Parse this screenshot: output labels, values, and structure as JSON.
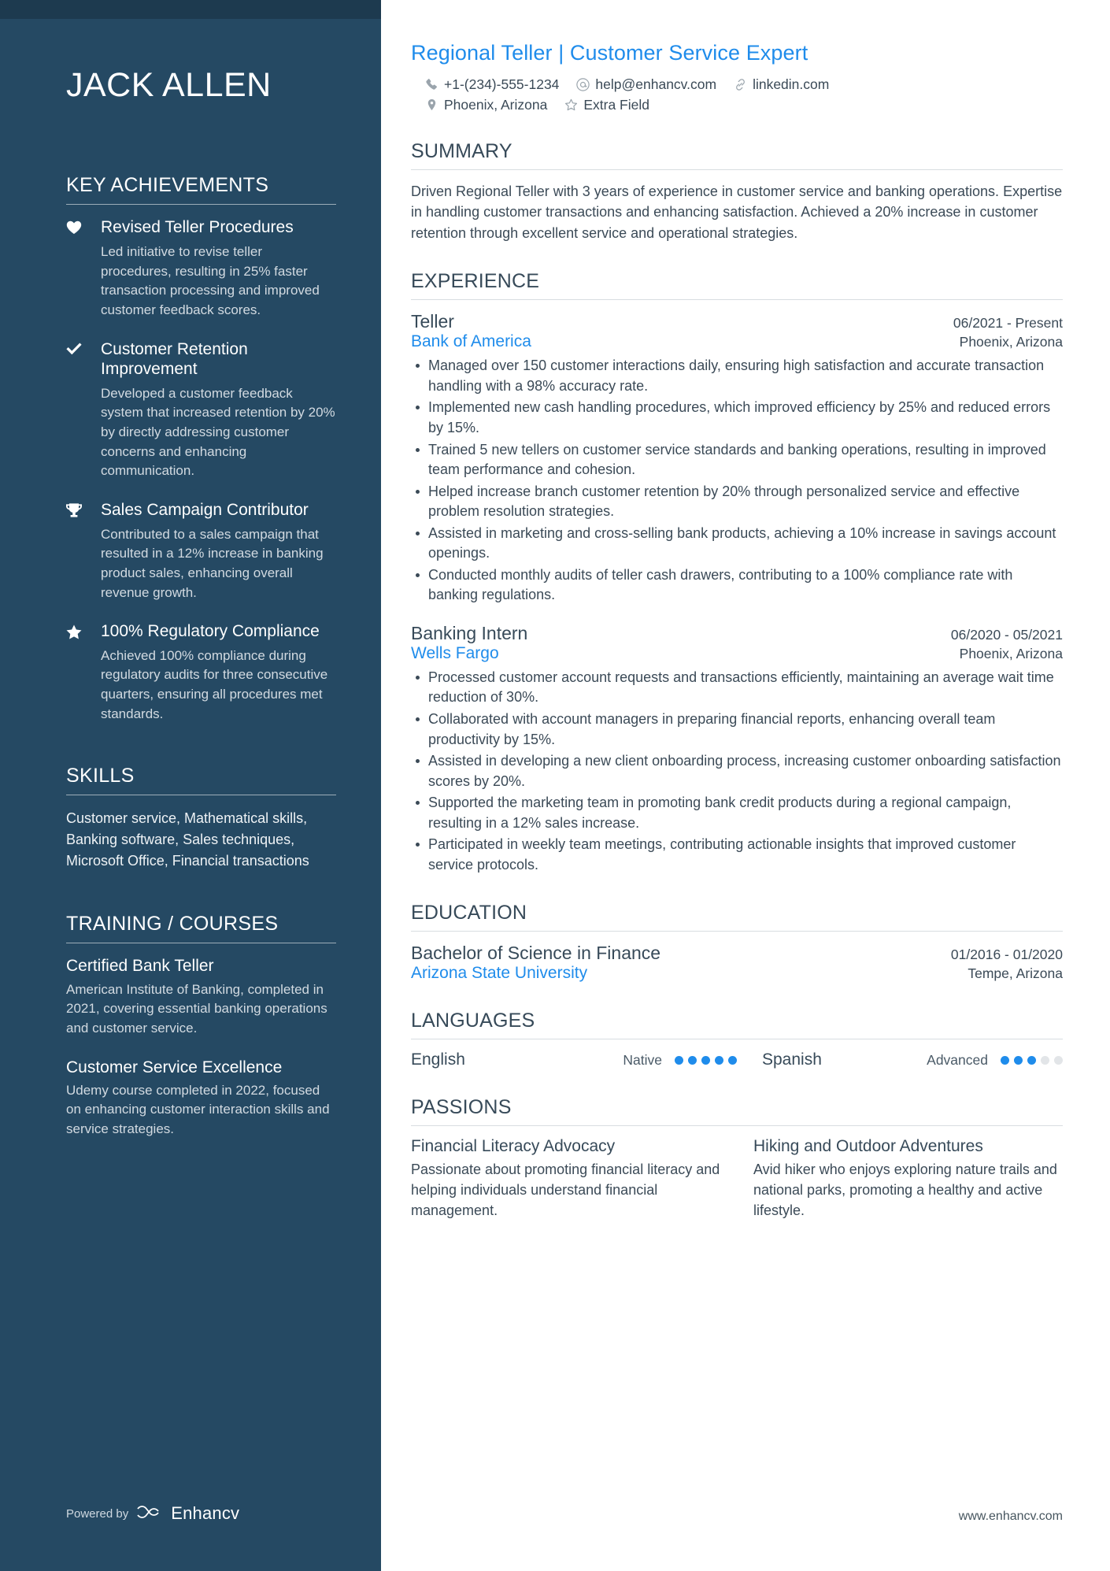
{
  "sidebar": {
    "name": "JACK ALLEN",
    "key_achievements": {
      "heading": "KEY ACHIEVEMENTS",
      "items": [
        {
          "icon": "heart-icon",
          "title": "Revised Teller Procedures",
          "description": "Led initiative to revise teller procedures, resulting in 25% faster transaction processing and improved customer feedback scores."
        },
        {
          "icon": "check-icon",
          "title": "Customer Retention Improvement",
          "description": "Developed a customer feedback system that increased retention by 20% by directly addressing customer concerns and enhancing communication."
        },
        {
          "icon": "trophy-icon",
          "title": "Sales Campaign Contributor",
          "description": "Contributed to a sales campaign that resulted in a 12% increase in banking product sales, enhancing overall revenue growth."
        },
        {
          "icon": "star-icon",
          "title": "100% Regulatory Compliance",
          "description": "Achieved 100% compliance during regulatory audits for three consecutive quarters, ensuring all procedures met standards."
        }
      ]
    },
    "skills": {
      "heading": "SKILLS",
      "text": "Customer service, Mathematical skills, Banking software, Sales techniques, Microsoft Office, Financial transactions"
    },
    "training": {
      "heading": "TRAINING / COURSES",
      "items": [
        {
          "title": "Certified Bank Teller",
          "description": "American Institute of Banking, completed in 2021, covering essential banking operations and customer service."
        },
        {
          "title": "Customer Service Excellence",
          "description": "Udemy course completed in 2022, focused on enhancing customer interaction skills and service strategies."
        }
      ]
    },
    "footer": {
      "powered_by": "Powered by",
      "brand": "Enhancv"
    }
  },
  "main": {
    "headline": "Regional Teller | Customer Service Expert",
    "contacts": [
      {
        "icon": "phone-icon",
        "text": "+1-(234)-555-1234"
      },
      {
        "icon": "email-icon",
        "text": "help@enhancv.com"
      },
      {
        "icon": "link-icon",
        "text": "linkedin.com"
      },
      {
        "icon": "location-pin-icon",
        "text": "Phoenix, Arizona"
      },
      {
        "icon": "star-outline-icon",
        "text": "Extra Field"
      }
    ],
    "summary": {
      "heading": "SUMMARY",
      "text": "Driven Regional Teller with 3 years of experience in customer service and banking operations. Expertise in handling customer transactions and enhancing satisfaction. Achieved a 20% increase in customer retention through excellent service and operational strategies."
    },
    "experience": {
      "heading": "EXPERIENCE",
      "entries": [
        {
          "title": "Teller",
          "date": "06/2021 - Present",
          "organization": "Bank of America",
          "location": "Phoenix, Arizona",
          "bullets": [
            "Managed over 150 customer interactions daily, ensuring high satisfaction and accurate transaction handling with a 98% accuracy rate.",
            "Implemented new cash handling procedures, which improved efficiency by 25% and reduced errors by 15%.",
            "Trained 5 new tellers on customer service standards and banking operations, resulting in improved team performance and cohesion.",
            "Helped increase branch customer retention by 20% through personalized service and effective problem resolution strategies.",
            "Assisted in marketing and cross-selling bank products, achieving a 10% increase in savings account openings.",
            "Conducted monthly audits of teller cash drawers, contributing to a 100% compliance rate with banking regulations."
          ]
        },
        {
          "title": "Banking Intern",
          "date": "06/2020 - 05/2021",
          "organization": "Wells Fargo",
          "location": "Phoenix, Arizona",
          "bullets": [
            "Processed customer account requests and transactions efficiently, maintaining an average wait time reduction of 30%.",
            "Collaborated with account managers in preparing financial reports, enhancing overall team productivity by 15%.",
            "Assisted in developing a new client onboarding process, increasing customer onboarding satisfaction scores by 20%.",
            "Supported the marketing team in promoting bank credit products during a regional campaign, resulting in a 12% sales increase.",
            "Participated in weekly team meetings, contributing actionable insights that improved customer service protocols."
          ]
        }
      ]
    },
    "education": {
      "heading": "EDUCATION",
      "entries": [
        {
          "title": "Bachelor of Science in Finance",
          "date": "01/2016 - 01/2020",
          "organization": "Arizona State University",
          "location": "Tempe, Arizona"
        }
      ]
    },
    "languages": {
      "heading": "LANGUAGES",
      "items": [
        {
          "name": "English",
          "level": "Native",
          "filled": 5,
          "total": 5
        },
        {
          "name": "Spanish",
          "level": "Advanced",
          "filled": 3,
          "total": 5
        }
      ]
    },
    "passions": {
      "heading": "PASSIONS",
      "items": [
        {
          "title": "Financial Literacy Advocacy",
          "description": "Passionate about promoting financial literacy and helping individuals understand financial management."
        },
        {
          "title": "Hiking and Outdoor Adventures",
          "description": "Avid hiker who enjoys exploring nature trails and national parks, promoting a healthy and active lifestyle."
        }
      ]
    },
    "footer_url": "www.enhancv.com"
  },
  "colors": {
    "sidebar_bg": "#254963",
    "accent_blue": "#1f8ceb",
    "body_text": "#3b4a57"
  }
}
